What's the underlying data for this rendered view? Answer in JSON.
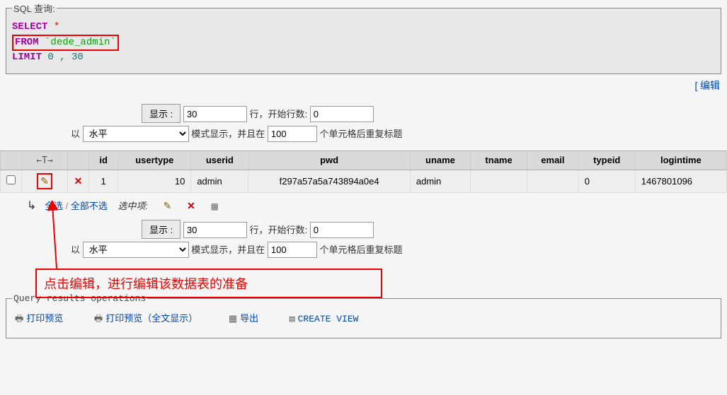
{
  "sql_box": {
    "legend": "SQL 查询:",
    "select_kw": "SELECT",
    "star": "*",
    "from_kw": "FROM",
    "table_name": "`dede_admin`",
    "limit_kw": "LIMIT",
    "limit_vals": "0 , 30"
  },
  "edit_link": {
    "bracket": "[",
    "text": "编辑"
  },
  "controls_top": {
    "show_btn": "显示 :",
    "rows_value": "30",
    "rows_label": "行，开始行数:",
    "start_value": "0",
    "by_label": "以",
    "mode_value": "水平",
    "mode_label": "模式显示，并且在",
    "repeat_value": "100",
    "repeat_label": "个单元格后重复标题"
  },
  "table": {
    "headers": [
      "id",
      "usertype",
      "userid",
      "pwd",
      "uname",
      "tname",
      "email",
      "typeid",
      "logintime"
    ],
    "sort_handle": "←T→",
    "row": {
      "id": "1",
      "usertype": "10",
      "userid": "admin",
      "pwd": "f297a57a5a743894a0e4",
      "uname": "admin",
      "tname": "",
      "email": "",
      "typeid": "0",
      "logintime": "1467801096"
    }
  },
  "bulk": {
    "select_all": "全选",
    "deselect_all": "全部不选",
    "selected_label": "选中项:"
  },
  "controls_bottom": {
    "show_btn": "显示 :",
    "rows_value": "30",
    "rows_label": "行，开始行数:",
    "start_value": "0",
    "by_label": "以",
    "mode_value": "水平",
    "mode_label": "模式显示，并且在",
    "repeat_value": "100",
    "repeat_label": "个单元格后重复标题"
  },
  "annotation": "点击编辑，进行编辑该数据表的准备",
  "qro": {
    "legend": "Query results operations",
    "print_preview": "打印预览",
    "print_preview_full": "打印预览（全文显示）",
    "export": "导出",
    "create_view": "CREATE VIEW"
  }
}
